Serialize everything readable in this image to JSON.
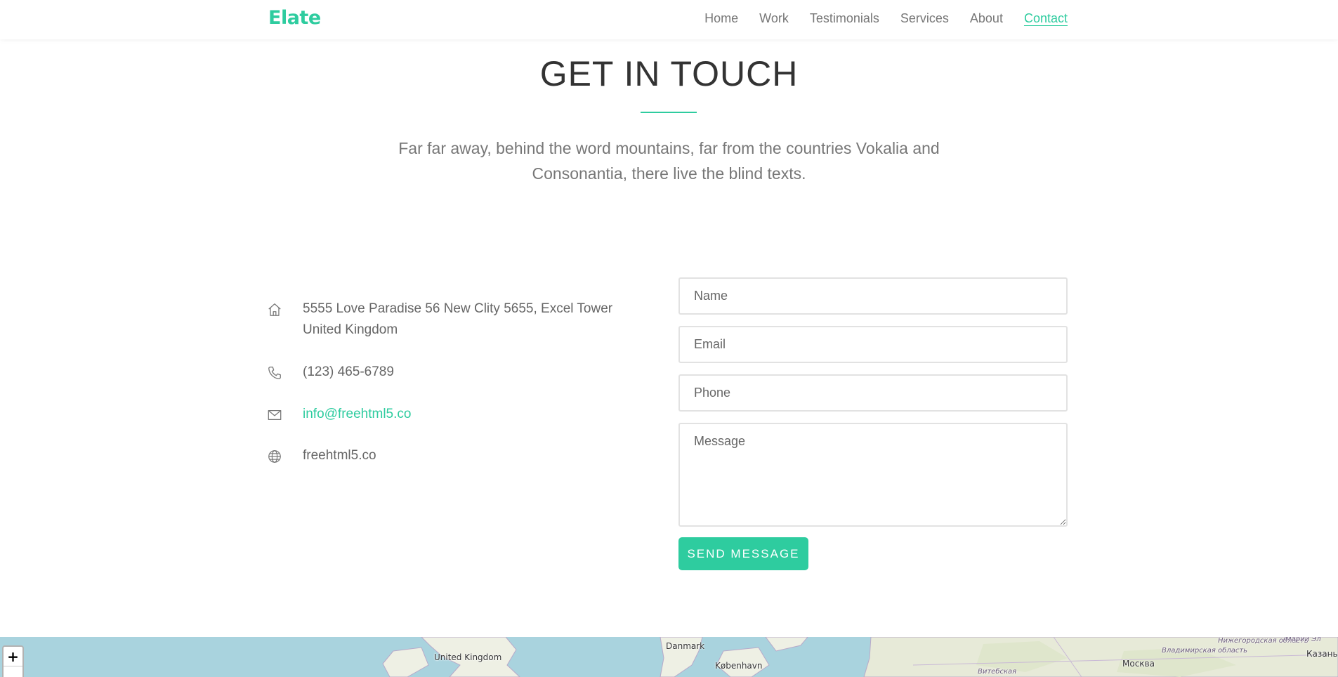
{
  "nav": {
    "brand": "Elate",
    "items": [
      {
        "label": "Home"
      },
      {
        "label": "Work"
      },
      {
        "label": "Testimonials"
      },
      {
        "label": "Services"
      },
      {
        "label": "About"
      },
      {
        "label": "Contact",
        "active": true
      }
    ]
  },
  "section": {
    "title": "GET IN TOUCH",
    "intro": "Far far away, behind the word mountains, far from the countries Vokalia and Consonantia, there live the blind texts."
  },
  "contact": {
    "address": "5555 Love Paradise 56 New Clity 5655, Excel Tower United Kingdom",
    "phone": "(123) 465-6789",
    "email": "info@freehtml5.co",
    "website": "freehtml5.co",
    "icons": {
      "address": "home-icon",
      "phone": "phone-icon",
      "email": "mail-icon",
      "website": "globe-icon"
    }
  },
  "form": {
    "name_placeholder": "Name",
    "email_placeholder": "Email",
    "phone_placeholder": "Phone",
    "message_placeholder": "Message",
    "submit_label": "SEND MESSAGE"
  },
  "map": {
    "labels": [
      "United Kingdom",
      "Danmark",
      "København",
      "Москва",
      "Казань",
      "Нижегородская область",
      "Владимирская область",
      "Витебская",
      "Марий Эл"
    ],
    "zoom_in": "+"
  },
  "colors": {
    "accent": "#2ecc9f",
    "water": "#a9d3de",
    "land": "#eef0e4"
  }
}
